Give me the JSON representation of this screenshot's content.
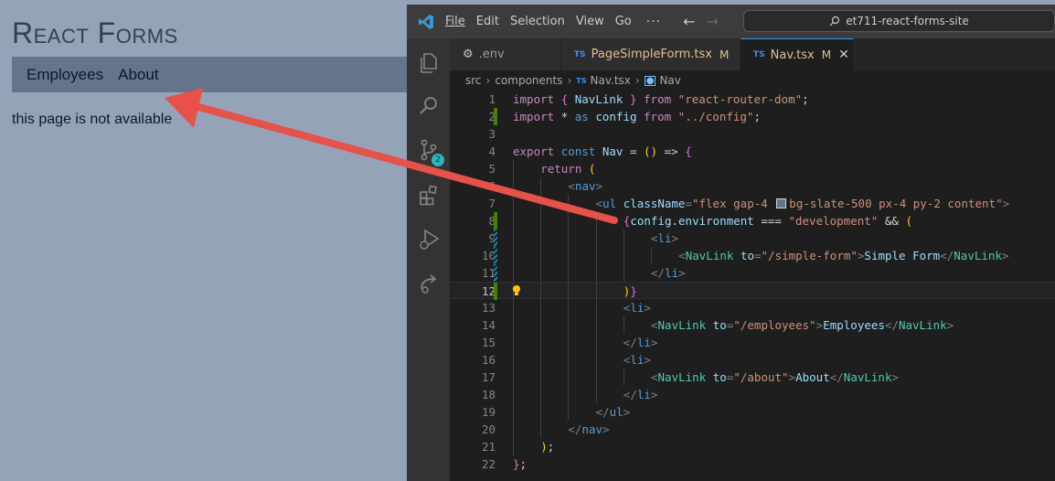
{
  "app": {
    "title": "React Forms",
    "nav": [
      "Employees",
      "About"
    ],
    "message": "this page is not available"
  },
  "vscode": {
    "menu": [
      "File",
      "Edit",
      "Selection",
      "View",
      "Go"
    ],
    "more": "···",
    "search": "et711-react-forms-site",
    "scm_badge": "2",
    "tabs": [
      {
        "label": ".env",
        "type": "env"
      },
      {
        "label": "PageSimpleForm.tsx",
        "modified": "M",
        "type": "ts"
      },
      {
        "label": "Nav.tsx",
        "modified": "M",
        "type": "ts",
        "active": true
      }
    ],
    "breadcrumb": [
      "src",
      "components",
      "Nav.tsx",
      "Nav"
    ],
    "line_numbers": [
      "1",
      "2",
      "3",
      "4",
      "5",
      "6",
      "7",
      "8",
      "9",
      "10",
      "11",
      "12",
      "13",
      "14",
      "15",
      "16",
      "17",
      "18",
      "19",
      "20",
      "21",
      "22"
    ],
    "code_lines": [
      "import { NavLink } from \"react-router-dom\";",
      "import * as config from \"../config\";",
      "",
      "export const Nav = () => {",
      "return (",
      "<nav>",
      "<ul className=\"flex gap-4 bg-slate-500 px-4 py-2 content\">",
      "{config.environment === \"development\" && (",
      "<li>",
      "<NavLink to=\"/simple-form\">Simple Form</NavLink>",
      "</li>",
      ")}",
      "<li>",
      "<NavLink to=\"/employees\">Employees</NavLink>",
      "</li>",
      "<li>",
      "<NavLink to=\"/about\">About</NavLink>",
      "</li>",
      "</ul>",
      "</nav>",
      ");",
      "};"
    ],
    "colors": {
      "accent": "#3794ff",
      "added": "#487e02",
      "modified": "#1b81a8",
      "arrow": "#e8504a"
    }
  }
}
